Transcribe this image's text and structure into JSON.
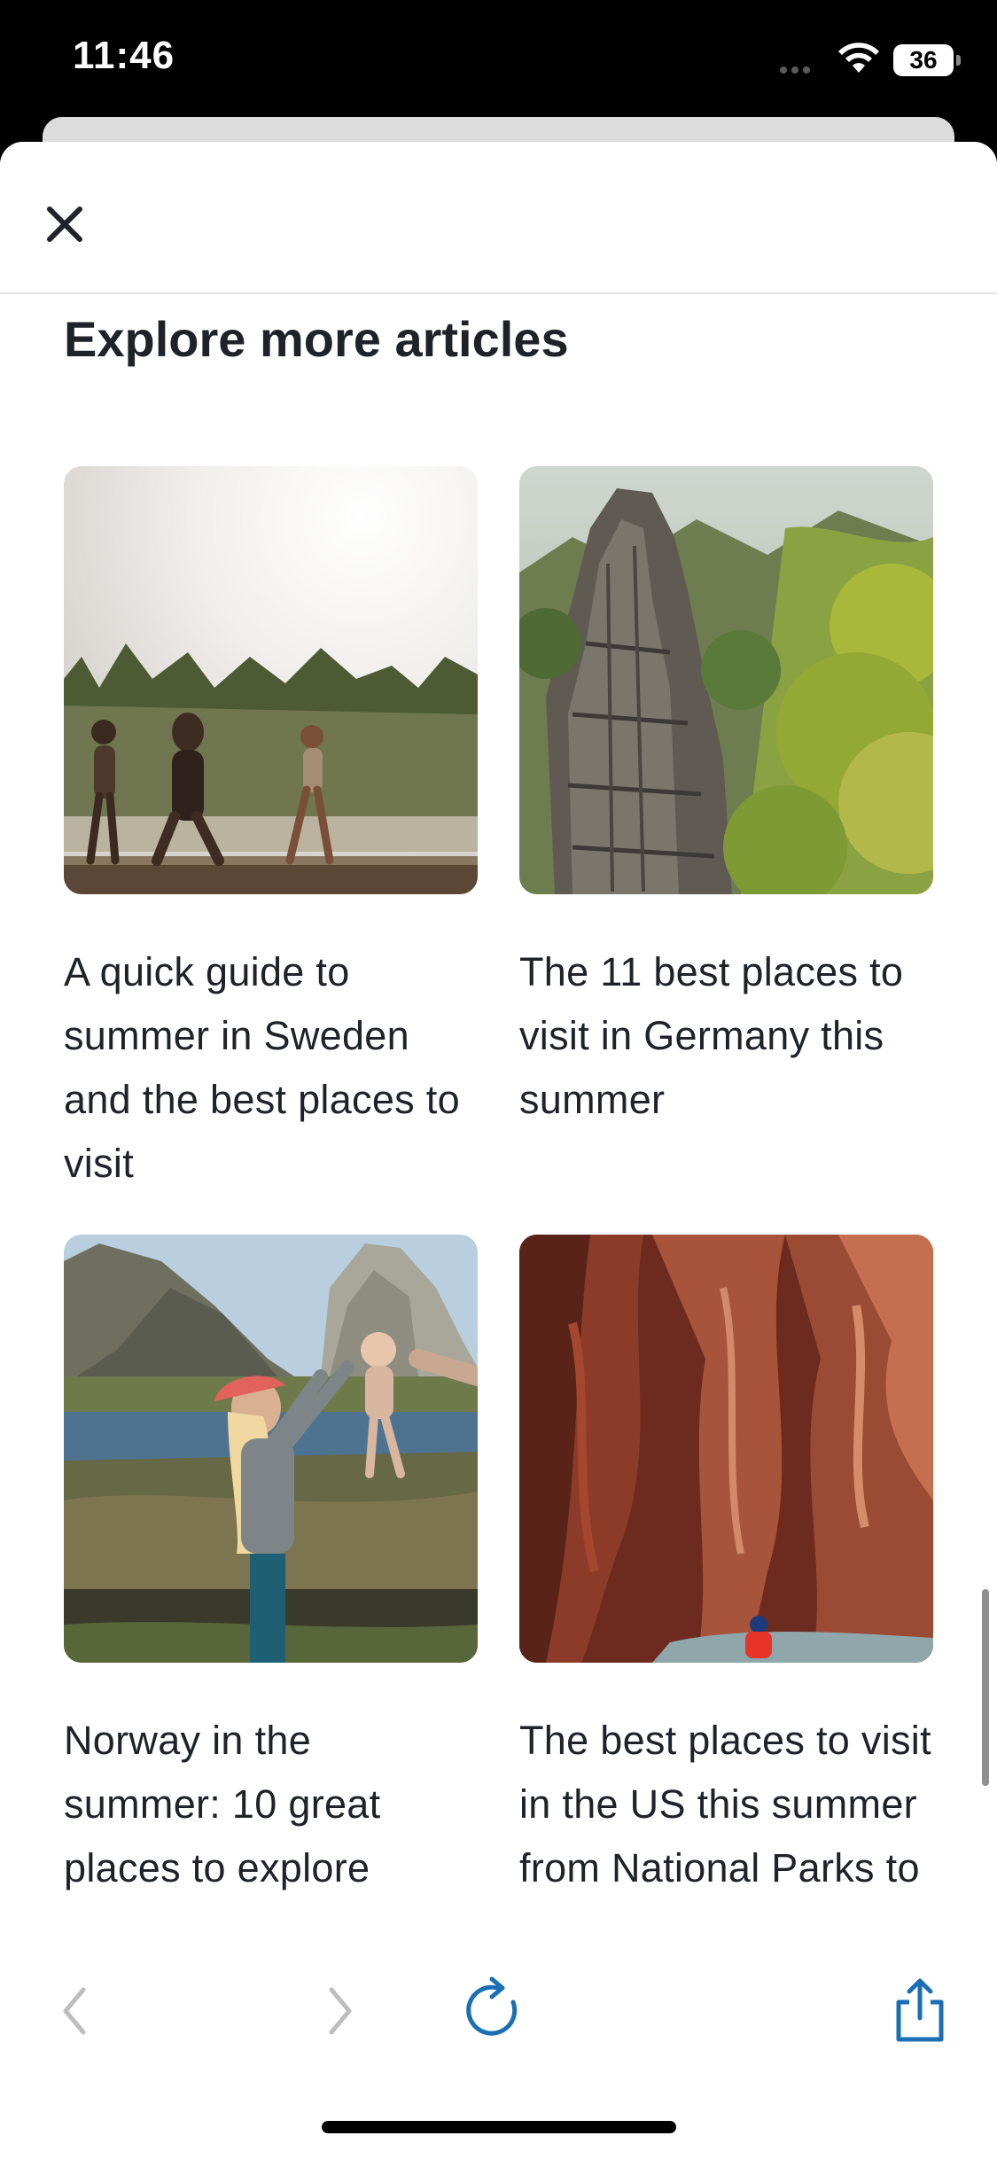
{
  "status_bar": {
    "time": "11:46",
    "battery": "36"
  },
  "header": {
    "close_icon": "close-icon"
  },
  "section": {
    "title": "Explore more articles"
  },
  "articles": [
    {
      "title": "A quick guide to summer in Sweden and the best places to visit",
      "image": "family-walking-on-dock-by-lake"
    },
    {
      "title": "The 11 best places to visit in Germany this summer",
      "image": "sandstone-rock-tower-in-forest"
    },
    {
      "title": "Norway in the summer: 10 great places to explore",
      "image": "mother-lifting-baby-by-fjord"
    },
    {
      "title": "The best places to visit in the US this summer from National Parks to",
      "image": "red-sandstone-slot-canyon"
    }
  ],
  "toolbar": {
    "back_icon": "chevron-left-icon",
    "forward_icon": "chevron-right-icon",
    "reload_icon": "reload-icon",
    "share_icon": "share-icon"
  },
  "colors": {
    "accent": "#1a6fb5",
    "text": "#1f2329",
    "disabled": "#bdbdbd"
  }
}
